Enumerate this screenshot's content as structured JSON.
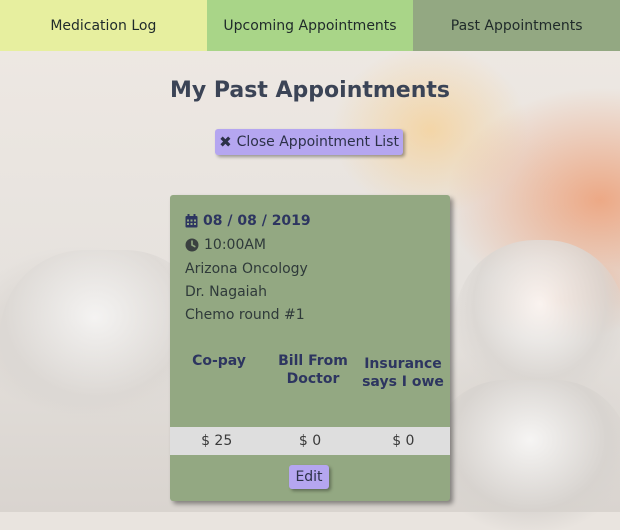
{
  "nav": {
    "tabs": [
      {
        "label": "Medication Log",
        "color": "#e7ef9f"
      },
      {
        "label": "Upcoming Appointments",
        "color": "#a9d588"
      },
      {
        "label": "Past Appointments",
        "color": "#93a882"
      }
    ]
  },
  "page": {
    "title": "My Past Appointments",
    "close_button_label": "Close Appointment List"
  },
  "appointment": {
    "date": "08 / 08 / 2019",
    "time": "10:00AM",
    "location": "Arizona Oncology",
    "doctor": "Dr. Nagaiah",
    "note": "Chemo round #1",
    "columns": [
      "Co-pay",
      "Bill From Doctor",
      "Insurance says I owe"
    ],
    "values": [
      "$ 25",
      "$ 0",
      "$ 0"
    ],
    "edit_label": "Edit"
  },
  "colors": {
    "button": "#b5a6f0",
    "card": "#93a882",
    "title_text": "#3b4456"
  },
  "icons": {
    "date": "calendar-icon",
    "time": "clock-icon",
    "close": "close-icon"
  }
}
